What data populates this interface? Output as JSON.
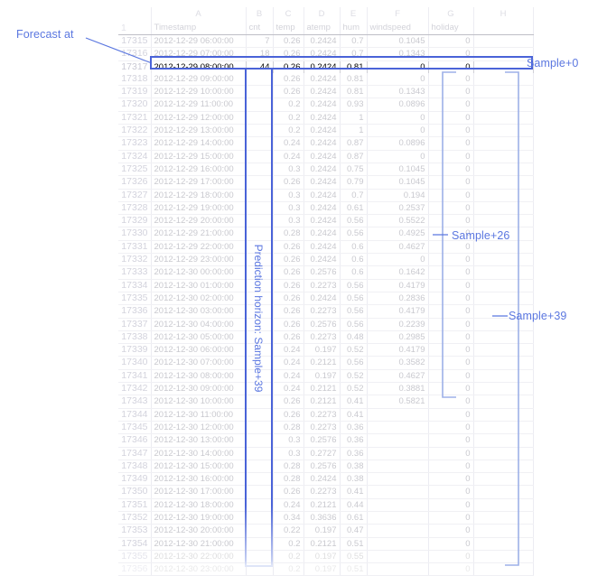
{
  "annotations": {
    "forecast_at": "Forecast at",
    "sample_0": "Sample+0",
    "sample_26": "Sample+26",
    "sample_39": "Sample+39",
    "horizon": "Prediction horizon: Sample+39"
  },
  "colors": {
    "accent": "#5b77e0",
    "selection_border": "#4a63d8",
    "bracket": "#9db0e8",
    "grid_line": "#ececf2",
    "faded_text": "#c9c9cf"
  },
  "sheet": {
    "column_letters": [
      "A",
      "B",
      "C",
      "D",
      "E",
      "F",
      "G",
      "H"
    ],
    "headers": [
      "Timestamp",
      "cnt",
      "temp",
      "atemp",
      "hum",
      "windspeed",
      "holiday",
      ""
    ],
    "header_row_number": "1",
    "rows": [
      {
        "n": "17315",
        "ts": "2012-12-29 06:00:00",
        "cnt": "7",
        "temp": "0.26",
        "atemp": "0.2424",
        "hum": "0.7",
        "windspeed": "0.1045",
        "holiday": "0",
        "h": ""
      },
      {
        "n": "17316",
        "ts": "2012-12-29 07:00:00",
        "cnt": "18",
        "temp": "0.26",
        "atemp": "0.2424",
        "hum": "0.7",
        "windspeed": "0.1343",
        "holiday": "0",
        "h": ""
      },
      {
        "n": "17317",
        "ts": "2012-12-29 08:00:00",
        "cnt": "44",
        "temp": "0.26",
        "atemp": "0.2424",
        "hum": "0.81",
        "windspeed": "0",
        "holiday": "0",
        "h": ""
      },
      {
        "n": "17318",
        "ts": "2012-12-29 09:00:00",
        "cnt": "",
        "temp": "0.26",
        "atemp": "0.2424",
        "hum": "0.81",
        "windspeed": "0",
        "holiday": "0",
        "h": ""
      },
      {
        "n": "17319",
        "ts": "2012-12-29 10:00:00",
        "cnt": "",
        "temp": "0.26",
        "atemp": "0.2424",
        "hum": "0.81",
        "windspeed": "0.1343",
        "holiday": "0",
        "h": ""
      },
      {
        "n": "17320",
        "ts": "2012-12-29 11:00:00",
        "cnt": "",
        "temp": "0.2",
        "atemp": "0.2424",
        "hum": "0.93",
        "windspeed": "0.0896",
        "holiday": "0",
        "h": ""
      },
      {
        "n": "17321",
        "ts": "2012-12-29 12:00:00",
        "cnt": "",
        "temp": "0.2",
        "atemp": "0.2424",
        "hum": "1",
        "windspeed": "0",
        "holiday": "0",
        "h": ""
      },
      {
        "n": "17322",
        "ts": "2012-12-29 13:00:00",
        "cnt": "",
        "temp": "0.2",
        "atemp": "0.2424",
        "hum": "1",
        "windspeed": "0",
        "holiday": "0",
        "h": ""
      },
      {
        "n": "17323",
        "ts": "2012-12-29 14:00:00",
        "cnt": "",
        "temp": "0.24",
        "atemp": "0.2424",
        "hum": "0.87",
        "windspeed": "0.0896",
        "holiday": "0",
        "h": ""
      },
      {
        "n": "17324",
        "ts": "2012-12-29 15:00:00",
        "cnt": "",
        "temp": "0.24",
        "atemp": "0.2424",
        "hum": "0.87",
        "windspeed": "0",
        "holiday": "0",
        "h": ""
      },
      {
        "n": "17325",
        "ts": "2012-12-29 16:00:00",
        "cnt": "",
        "temp": "0.3",
        "atemp": "0.2424",
        "hum": "0.75",
        "windspeed": "0.1045",
        "holiday": "0",
        "h": ""
      },
      {
        "n": "17326",
        "ts": "2012-12-29 17:00:00",
        "cnt": "",
        "temp": "0.26",
        "atemp": "0.2424",
        "hum": "0.79",
        "windspeed": "0.1045",
        "holiday": "0",
        "h": ""
      },
      {
        "n": "17327",
        "ts": "2012-12-29 18:00:00",
        "cnt": "",
        "temp": "0.3",
        "atemp": "0.2424",
        "hum": "0.7",
        "windspeed": "0.194",
        "holiday": "0",
        "h": ""
      },
      {
        "n": "17328",
        "ts": "2012-12-29 19:00:00",
        "cnt": "",
        "temp": "0.3",
        "atemp": "0.2424",
        "hum": "0.61",
        "windspeed": "0.2537",
        "holiday": "0",
        "h": ""
      },
      {
        "n": "17329",
        "ts": "2012-12-29 20:00:00",
        "cnt": "",
        "temp": "0.3",
        "atemp": "0.2424",
        "hum": "0.56",
        "windspeed": "0.5522",
        "holiday": "0",
        "h": ""
      },
      {
        "n": "17330",
        "ts": "2012-12-29 21:00:00",
        "cnt": "",
        "temp": "0.28",
        "atemp": "0.2424",
        "hum": "0.56",
        "windspeed": "0.4925",
        "holiday": "0",
        "h": ""
      },
      {
        "n": "17331",
        "ts": "2012-12-29 22:00:00",
        "cnt": "",
        "temp": "0.26",
        "atemp": "0.2424",
        "hum": "0.6",
        "windspeed": "0.4627",
        "holiday": "0",
        "h": ""
      },
      {
        "n": "17332",
        "ts": "2012-12-29 23:00:00",
        "cnt": "",
        "temp": "0.26",
        "atemp": "0.2424",
        "hum": "0.6",
        "windspeed": "0",
        "holiday": "0",
        "h": ""
      },
      {
        "n": "17333",
        "ts": "2012-12-30 00:00:00",
        "cnt": "",
        "temp": "0.26",
        "atemp": "0.2576",
        "hum": "0.6",
        "windspeed": "0.1642",
        "holiday": "0",
        "h": ""
      },
      {
        "n": "17334",
        "ts": "2012-12-30 01:00:00",
        "cnt": "",
        "temp": "0.26",
        "atemp": "0.2273",
        "hum": "0.56",
        "windspeed": "0.4179",
        "holiday": "0",
        "h": ""
      },
      {
        "n": "17335",
        "ts": "2012-12-30 02:00:00",
        "cnt": "",
        "temp": "0.26",
        "atemp": "0.2424",
        "hum": "0.56",
        "windspeed": "0.2836",
        "holiday": "0",
        "h": ""
      },
      {
        "n": "17336",
        "ts": "2012-12-30 03:00:00",
        "cnt": "",
        "temp": "0.26",
        "atemp": "0.2273",
        "hum": "0.56",
        "windspeed": "0.4179",
        "holiday": "0",
        "h": ""
      },
      {
        "n": "17337",
        "ts": "2012-12-30 04:00:00",
        "cnt": "",
        "temp": "0.26",
        "atemp": "0.2576",
        "hum": "0.56",
        "windspeed": "0.2239",
        "holiday": "0",
        "h": ""
      },
      {
        "n": "17338",
        "ts": "2012-12-30 05:00:00",
        "cnt": "",
        "temp": "0.26",
        "atemp": "0.2273",
        "hum": "0.48",
        "windspeed": "0.2985",
        "holiday": "0",
        "h": ""
      },
      {
        "n": "17339",
        "ts": "2012-12-30 06:00:00",
        "cnt": "",
        "temp": "0.24",
        "atemp": "0.197",
        "hum": "0.52",
        "windspeed": "0.4179",
        "holiday": "0",
        "h": ""
      },
      {
        "n": "17340",
        "ts": "2012-12-30 07:00:00",
        "cnt": "",
        "temp": "0.24",
        "atemp": "0.2121",
        "hum": "0.56",
        "windspeed": "0.3582",
        "holiday": "0",
        "h": ""
      },
      {
        "n": "17341",
        "ts": "2012-12-30 08:00:00",
        "cnt": "",
        "temp": "0.24",
        "atemp": "0.197",
        "hum": "0.52",
        "windspeed": "0.4627",
        "holiday": "0",
        "h": ""
      },
      {
        "n": "17342",
        "ts": "2012-12-30 09:00:00",
        "cnt": "",
        "temp": "0.24",
        "atemp": "0.2121",
        "hum": "0.52",
        "windspeed": "0.3881",
        "holiday": "0",
        "h": ""
      },
      {
        "n": "17343",
        "ts": "2012-12-30 10:00:00",
        "cnt": "",
        "temp": "0.26",
        "atemp": "0.2121",
        "hum": "0.41",
        "windspeed": "0.5821",
        "holiday": "0",
        "h": ""
      },
      {
        "n": "17344",
        "ts": "2012-12-30 11:00:00",
        "cnt": "",
        "temp": "0.26",
        "atemp": "0.2273",
        "hum": "0.41",
        "windspeed": "",
        "holiday": "0",
        "h": ""
      },
      {
        "n": "17345",
        "ts": "2012-12-30 12:00:00",
        "cnt": "",
        "temp": "0.28",
        "atemp": "0.2273",
        "hum": "0.36",
        "windspeed": "",
        "holiday": "0",
        "h": ""
      },
      {
        "n": "17346",
        "ts": "2012-12-30 13:00:00",
        "cnt": "",
        "temp": "0.3",
        "atemp": "0.2576",
        "hum": "0.36",
        "windspeed": "",
        "holiday": "0",
        "h": ""
      },
      {
        "n": "17347",
        "ts": "2012-12-30 14:00:00",
        "cnt": "",
        "temp": "0.3",
        "atemp": "0.2727",
        "hum": "0.36",
        "windspeed": "",
        "holiday": "0",
        "h": ""
      },
      {
        "n": "17348",
        "ts": "2012-12-30 15:00:00",
        "cnt": "",
        "temp": "0.28",
        "atemp": "0.2576",
        "hum": "0.38",
        "windspeed": "",
        "holiday": "0",
        "h": ""
      },
      {
        "n": "17349",
        "ts": "2012-12-30 16:00:00",
        "cnt": "",
        "temp": "0.28",
        "atemp": "0.2424",
        "hum": "0.38",
        "windspeed": "",
        "holiday": "0",
        "h": ""
      },
      {
        "n": "17350",
        "ts": "2012-12-30 17:00:00",
        "cnt": "",
        "temp": "0.26",
        "atemp": "0.2273",
        "hum": "0.41",
        "windspeed": "",
        "holiday": "0",
        "h": ""
      },
      {
        "n": "17351",
        "ts": "2012-12-30 18:00:00",
        "cnt": "",
        "temp": "0.24",
        "atemp": "0.2121",
        "hum": "0.44",
        "windspeed": "",
        "holiday": "0",
        "h": ""
      },
      {
        "n": "17352",
        "ts": "2012-12-30 19:00:00",
        "cnt": "",
        "temp": "0.34",
        "atemp": "0.3636",
        "hum": "0.61",
        "windspeed": "",
        "holiday": "0",
        "h": ""
      },
      {
        "n": "17353",
        "ts": "2012-12-30 20:00:00",
        "cnt": "",
        "temp": "0.22",
        "atemp": "0.197",
        "hum": "0.47",
        "windspeed": "",
        "holiday": "0",
        "h": ""
      },
      {
        "n": "17354",
        "ts": "2012-12-30 21:00:00",
        "cnt": "",
        "temp": "0.2",
        "atemp": "0.2121",
        "hum": "0.51",
        "windspeed": "",
        "holiday": "0",
        "h": ""
      },
      {
        "n": "17355",
        "ts": "2012-12-30 22:00:00",
        "cnt": "",
        "temp": "0.2",
        "atemp": "0.197",
        "hum": "0.55",
        "windspeed": "",
        "holiday": "0",
        "h": ""
      },
      {
        "n": "17356",
        "ts": "2012-12-30 23:00:00",
        "cnt": "",
        "temp": "0.2",
        "atemp": "0.197",
        "hum": "0.51",
        "windspeed": "",
        "holiday": "0",
        "h": ""
      }
    ],
    "selected_row_index": 2,
    "fade_rows": {
      "fade1": 40,
      "fade2": 41
    }
  }
}
